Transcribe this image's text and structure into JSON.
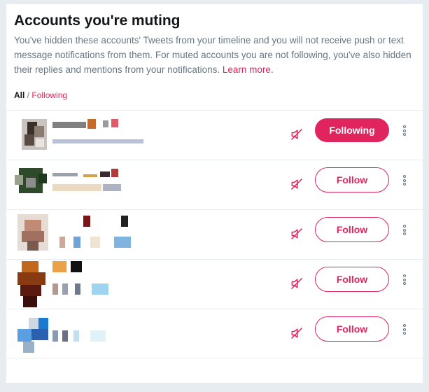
{
  "page": {
    "title": "Accounts you're muting",
    "description": "You've hidden these accounts' Tweets from your timeline and you will not receive push or text message notifications from them. For muted accounts you are not following, you've also hidden their replies and mentions from your notifications.",
    "learn_more": "Learn more."
  },
  "filter": {
    "all": "All",
    "separator": "/",
    "following": "Following"
  },
  "accounts": [
    {
      "button": "Following",
      "state": "following"
    },
    {
      "button": "Follow",
      "state": "follow"
    },
    {
      "button": "Follow",
      "state": "follow"
    },
    {
      "button": "Follow",
      "state": "follow"
    },
    {
      "button": "Follow",
      "state": "follow"
    }
  ],
  "colors": {
    "accent": "#e0245e",
    "text_secondary": "#657786",
    "background": "#e6ecf0"
  },
  "icons": {
    "mute": "muted-speaker-icon",
    "more": "more-vertical-icon"
  }
}
